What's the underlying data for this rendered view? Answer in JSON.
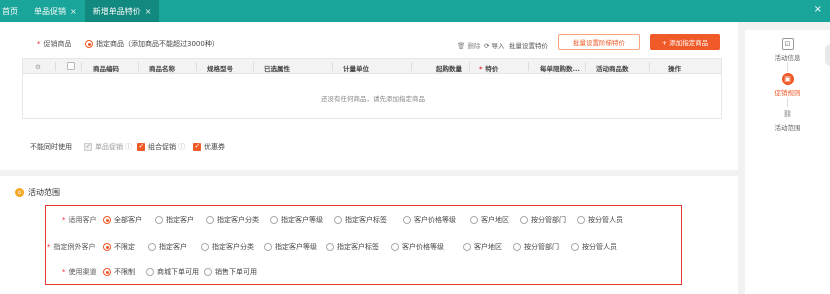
{
  "tabs": [
    {
      "label": "首页",
      "closable": false,
      "active": false
    },
    {
      "label": "单品促销",
      "closable": true,
      "active": false
    },
    {
      "label": "新增单品特价",
      "closable": true,
      "active": true
    }
  ],
  "close_all_icon": "close-icon",
  "products": {
    "label": "促销商品",
    "option": "指定商品（添加商品不能超过3000种）",
    "tools": {
      "delete": "删除",
      "import": "导入",
      "batch_set": "批量设置特价"
    },
    "batch_tier_button": "批量设置阶梯特价",
    "add_button": "+ 添加指定商品",
    "columns": [
      "商品编码",
      "商品名称",
      "规格型号",
      "已选属性",
      "计量单位",
      "起购数量",
      "特价",
      "每单限购数...",
      "活动商品数",
      "操作"
    ],
    "special_price_required": true,
    "empty_text": "还没有任何商品，请先添加指定商品"
  },
  "exclusive": {
    "label": "不能同时使用",
    "options": [
      {
        "label": "单品促销",
        "checked": true,
        "disabled": true,
        "help": "?"
      },
      {
        "label": "组合促销",
        "checked": true,
        "disabled": false,
        "help": "?"
      },
      {
        "label": "优惠券",
        "checked": true,
        "disabled": false,
        "help": ""
      }
    ]
  },
  "scope": {
    "title": "活动范围",
    "rows": [
      {
        "label": "适用客户",
        "options": [
          {
            "label": "全部客户",
            "selected": true
          },
          {
            "label": "指定客户",
            "selected": false
          },
          {
            "label": "指定客户分类",
            "selected": false
          },
          {
            "label": "指定客户等级",
            "selected": false
          },
          {
            "label": "指定客户标签",
            "selected": false
          },
          {
            "label": "客户价格等级",
            "selected": false
          },
          {
            "label": "客户地区",
            "selected": false
          },
          {
            "label": "按分管部门",
            "selected": false
          },
          {
            "label": "按分管人员",
            "selected": false
          }
        ]
      },
      {
        "label": "指定例外客户",
        "options": [
          {
            "label": "不限定",
            "selected": true
          },
          {
            "label": "指定客户",
            "selected": false
          },
          {
            "label": "指定客户分类",
            "selected": false
          },
          {
            "label": "指定客户等级",
            "selected": false
          },
          {
            "label": "指定客户标签",
            "selected": false
          },
          {
            "label": "客户价格等级",
            "selected": false
          },
          {
            "label": "客户地区",
            "selected": false
          },
          {
            "label": "按分管部门",
            "selected": false
          },
          {
            "label": "按分管人员",
            "selected": false
          }
        ]
      },
      {
        "label": "使用渠道",
        "options": [
          {
            "label": "不限制",
            "selected": true
          },
          {
            "label": "商城下单可用",
            "selected": false
          },
          {
            "label": "销售下单可用",
            "selected": false
          }
        ]
      }
    ]
  },
  "rail": [
    {
      "label": "活动信息",
      "icon": "info-icon",
      "active": false
    },
    {
      "label": "促销规则",
      "icon": "rule-icon",
      "active": true
    },
    {
      "label": "活动范围",
      "icon": "scope-icon",
      "active": false
    }
  ],
  "accent_color": "#f05a28",
  "topbar_color": "#1aa59a"
}
